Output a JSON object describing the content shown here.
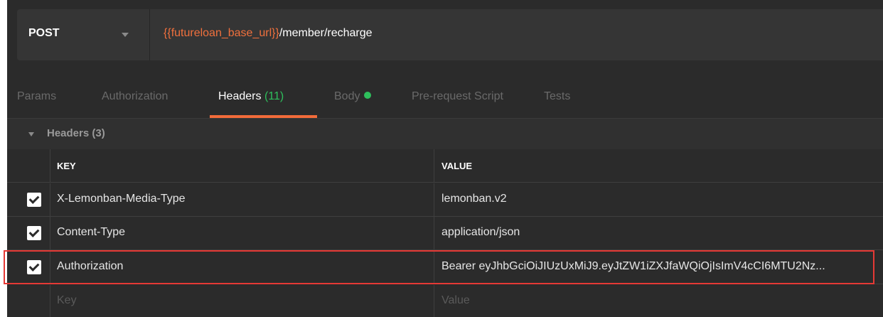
{
  "request": {
    "method": "POST",
    "url_variable": "{{futureloan_base_url}}",
    "url_path": "/member/recharge"
  },
  "tabs": [
    {
      "label": "Params"
    },
    {
      "label": "Authorization"
    },
    {
      "label": "Headers",
      "count": "(11)"
    },
    {
      "label": "Body"
    },
    {
      "label": "Pre-request Script"
    },
    {
      "label": "Tests"
    }
  ],
  "headers_section": {
    "title": "Headers (3)"
  },
  "table": {
    "columns": [
      "KEY",
      "VALUE"
    ],
    "rows": [
      {
        "checked": true,
        "key": "X-Lemonban-Media-Type",
        "value": "lemonban.v2"
      },
      {
        "checked": true,
        "key": "Content-Type",
        "value": "application/json"
      },
      {
        "checked": true,
        "key": "Authorization",
        "value": "Bearer eyJhbGciOiJIUzUxMiJ9.eyJtZW1iZXJfaWQiOjIsImV4cCI6MTU2Nz..."
      }
    ],
    "new_row": {
      "key_placeholder": "Key",
      "value_placeholder": "Value"
    }
  },
  "colors": {
    "url_variable": "#f0703d",
    "active_tab_underline": "#f26b3a",
    "count_green": "#2ebf5c",
    "highlight_border": "#e53935"
  }
}
